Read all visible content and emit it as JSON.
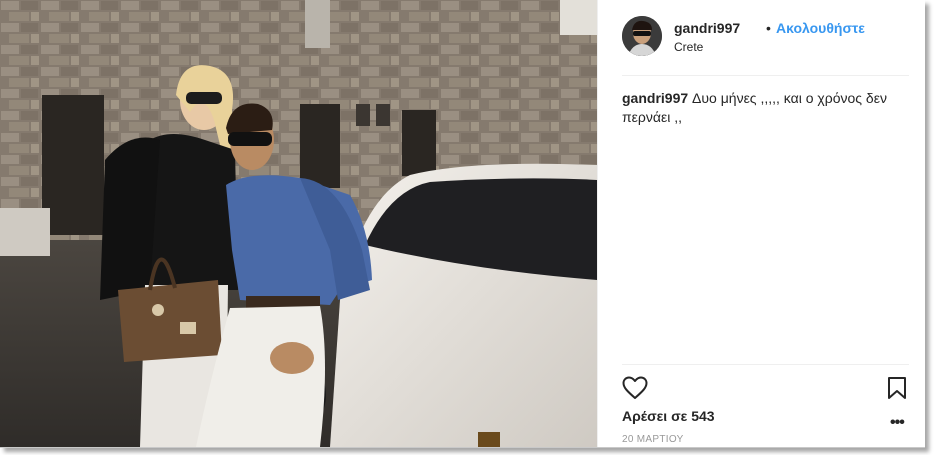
{
  "post": {
    "image_alt": "Couple posing in front of a white car beside a stone house",
    "author": {
      "username": "gandri997",
      "separator": "•",
      "follow_label": "Ακολουθήστε",
      "location": "Crete"
    },
    "caption": {
      "username": "gandri997",
      "text": "Δυο μήνες ,,,,, και ο χρόνος δεν περνάει ,,"
    },
    "likes_label": "Αρέσει σε 543",
    "date_label": "20 ΜΑΡΤΙΟΥ",
    "more_label": "•••",
    "icons": [
      "heart-icon",
      "bookmark-icon",
      "more-options-icon"
    ],
    "colors": {
      "follow": "#3897f0",
      "text": "#262626",
      "muted": "#999999",
      "divider": "#efefef"
    }
  }
}
